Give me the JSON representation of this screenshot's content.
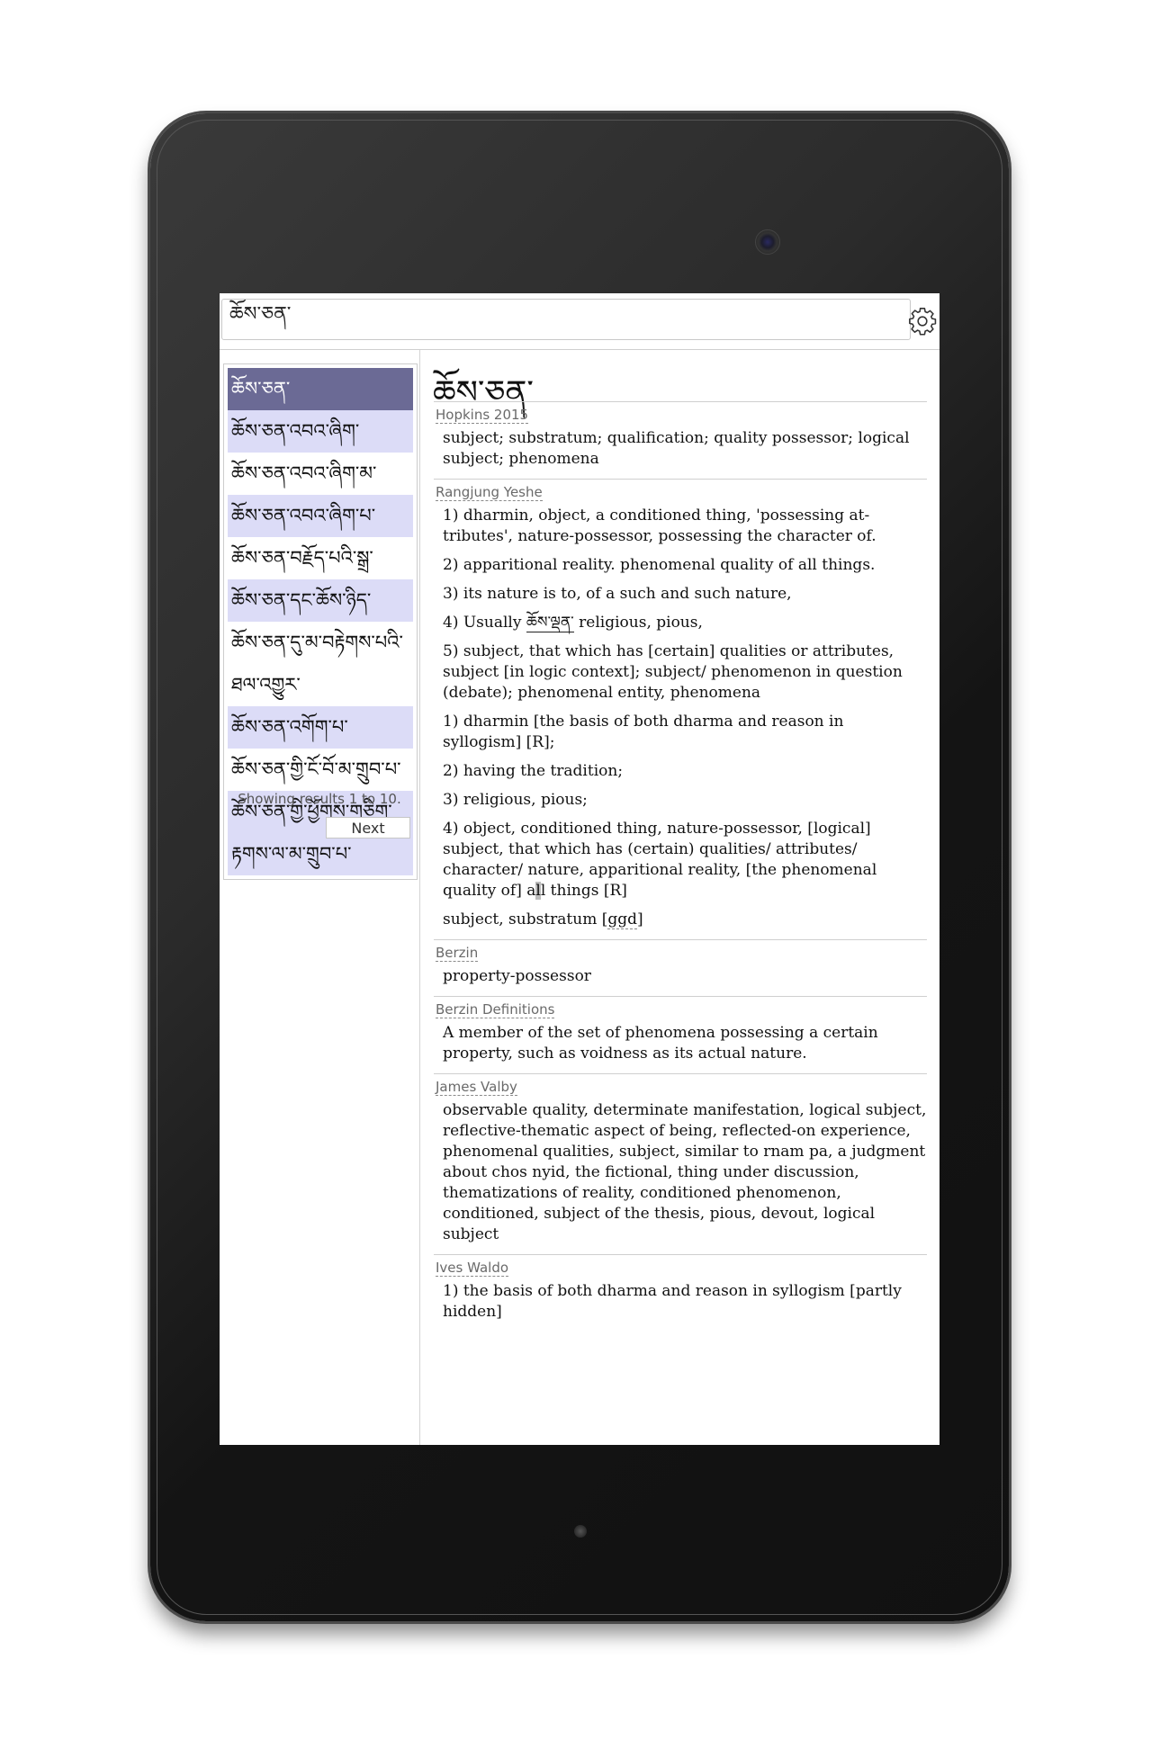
{
  "search": {
    "value": "ཆོས་ཅན་",
    "settings_icon": "gear-icon"
  },
  "sidebar": {
    "results": [
      {
        "text": "ཆོས་ཅན་",
        "state": "selected"
      },
      {
        "text": "ཆོས་ཅན་འབའ་ཞིག་",
        "state": "alt"
      },
      {
        "text": "ཆོས་ཅན་འབའ་ཞིག་མ་",
        "state": "normal"
      },
      {
        "text": "ཆོས་ཅན་འབའ་ཞིག་པ་",
        "state": "alt"
      },
      {
        "text": "ཆོས་ཅན་བརྗོད་པའི་སྒྲ་",
        "state": "normal"
      },
      {
        "text": "ཆོས་ཅན་དང་ཆོས་ཉིད་",
        "state": "alt"
      },
      {
        "text": "ཆོས་ཅན་དུ་མ་བརྟེགས་པའི་ཐལ་འགྱུར་",
        "state": "normal"
      },
      {
        "text": "ཆོས་ཅན་འགོག་པ་",
        "state": "alt"
      },
      {
        "text": "ཆོས་ཅན་གྱི་ངོ་བོ་མ་གྲུབ་པ་",
        "state": "normal"
      },
      {
        "text": "ཆོས་ཅན་གྱི་ཕྱོགས་གཅིག་རྟགས་ལ་མ་གྲུབ་པ་",
        "state": "alt"
      }
    ],
    "status": "Showing results 1 to 10.",
    "next_label": "Next"
  },
  "content": {
    "headword": "ཆོས་ཅན་",
    "entries": [
      {
        "source": "Hopkins 2015",
        "definitions": [
          "subject; substratum; qualification; quality possessor; logical subject; phenomena"
        ]
      },
      {
        "source": "Rangjung Yeshe",
        "definitions": [
          "1) dharmin, object, a conditioned thing, 'possessing at-tributes', nature-possessor, possessing the character of.",
          "2) apparitional reality. phenomenal quality of all things.",
          "3) its nature is to, of a such and such nature,",
          {
            "prefix": "4) Usually",
            "link": "ཆོས་ལྡན་",
            "suffix": "religious, pious,"
          },
          "5) subject, that which has [certain] qualities or attributes, subject [in logic context]; subject/ phenomenon in question (debate); phenomenal entity, phenomena",
          "1) dharmin [the basis of both dharma and reason in syllogism] [R];",
          "2) having the tradition;",
          "3) religious, pious;",
          {
            "before": "4) object, conditioned thing, nature-possessor, [logical] subject, that which has (certain) qualities/ attributes/ character/ nature, apparitional reality, [the phenomenal quality of] a",
            "cursor": "l",
            "after": "l things [R]"
          },
          {
            "text": "subject, substratum [",
            "abbr": "ggd",
            "end": "]"
          }
        ]
      },
      {
        "source": "Berzin",
        "definitions": [
          "property-possessor"
        ]
      },
      {
        "source": "Berzin Definitions",
        "definitions": [
          "A member of the set of phenomena possessing a certain property, such as voidness as its actual nature."
        ]
      },
      {
        "source": "James Valby",
        "definitions": [
          "observable quality, determinate manifestation, logical subject, reflective-thematic aspect of being, reflected-on experience, phenomenal qualities, subject, similar to rnam pa, a judgment about chos nyid, the fictional, thing under discussion, thematizations of reality, conditioned phenomenon, conditioned, subject of the thesis, pious, devout, logical subject"
        ]
      },
      {
        "source": "Ives Waldo",
        "definitions": [
          "1) the basis of both dharma and reason in syllogism [partly hidden]"
        ]
      }
    ]
  },
  "colors": {
    "selected_row": "#6b6a95",
    "alt_row": "#dcdcf7",
    "source_label": "#6a6a6a"
  }
}
